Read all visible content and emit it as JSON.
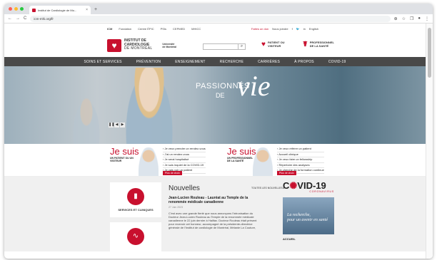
{
  "browser": {
    "tab_title": "Institut de Cardiologie de Mo...",
    "tab_close": "×",
    "new_tab": "+",
    "url": "icm-mhi.org/fr",
    "nav_icons": [
      "←",
      "→",
      "C"
    ],
    "right_icons": [
      "⊕",
      "☆",
      "❐",
      "●",
      "⋮"
    ]
  },
  "topnav": {
    "links": [
      "ICM",
      "Fondation",
      "Centre ÉPIC",
      "PSIs",
      "CEPMED",
      "MHICC"
    ],
    "donate": "Faites un don",
    "follow": "Nous joindre",
    "social": [
      "f",
      "🐦",
      "in"
    ],
    "lang": "English"
  },
  "header": {
    "logo_line1": "INSTITUT DE",
    "logo_line2": "CARDIOLOGIE",
    "logo_line3": "DE MONTRÉAL",
    "affil_line1": "Université",
    "affil_line2": "de Montréal",
    "search_btn": "⌕",
    "link1_line1": "PATIENT OU",
    "link1_line2": "VISITEUR",
    "link2_line1": "PROFESSIONNEL",
    "link2_line2": "DE LA SANTÉ"
  },
  "mainnav": [
    "SOINS ET SERVICES",
    "PRÉVENTION",
    "ENSEIGNEMENT",
    "RECHERCHE",
    "CARRIÈRES",
    "À PROPOS",
    "COVID-19"
  ],
  "hero": {
    "slogan1": "PASSIONNÉS",
    "slogan2": "DE",
    "slogan3": "vie",
    "arrows": [
      "❚❚",
      "◀",
      "▶"
    ]
  },
  "jesuis_patient": {
    "title": "Je suis",
    "sub": "UN PATIENT OU UN VISITEUR",
    "links": [
      "› Je veux prendre un rendez-vous",
      "› J'ai un rendez-vous",
      "› Je serai hospitalisé",
      "› Je suis inquiet de la COVID-19",
      "› Je vais voir un patient"
    ],
    "more": "Plus de choix"
  },
  "jesuis_pro": {
    "title": "Je suis",
    "sub": "UN PROFESSIONNEL DE LA SANTÉ",
    "links": [
      "› Je veux référer un patient",
      "› Accueil clinique",
      "› Je veux faire un fellowship",
      "› Répertoire des analyses",
      "› Je cherche de la formation continue"
    ],
    "more": "Plus de choix"
  },
  "cards": [
    {
      "label": "SERVICES ET CLINIQUES",
      "icon": "▮"
    },
    {
      "label": "",
      "icon": "∿"
    }
  ],
  "news": {
    "heading": "Nouvelles",
    "all": "TOUTES LES NOUVELLES ▸",
    "article_title": "Jean-Lucien Rouleau - Lauréat au Temple de la renommée médicale canadienne",
    "date": "27 Juin 2023",
    "body": "C'est avec une grande fierté que nous annonçons l'intronisation du Docteur Jean-Lucien Rouleau au Temple de la renommée médicale canadienne le 22 juin dernier à Halifax. Docteur Rouleau était présent pour recevoir cet honneur, accompagné de la présidente-directrice générale de l'Institut de cardiologie de Montréal, Mélanie La Couture,"
  },
  "covid": {
    "title_c": "C",
    "title_rest": "VID-19",
    "sub": "CORONAVIRUS",
    "img_text1": "La recherche,",
    "img_text2": "pour un avenir en santé",
    "bottom": "ACCUEIL"
  }
}
